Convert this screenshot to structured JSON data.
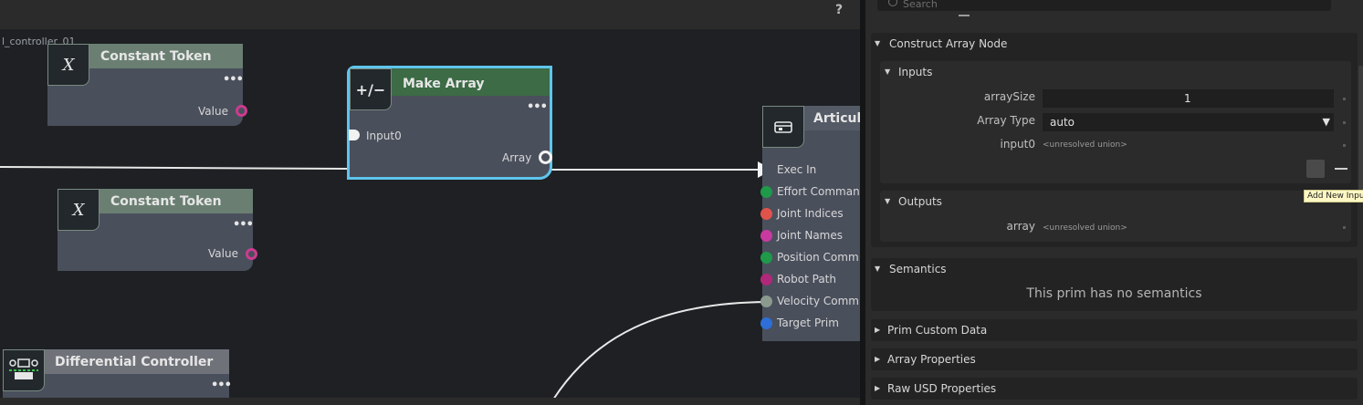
{
  "graph": {
    "help_label": "?",
    "graph_name": "l_controller_01",
    "nodes": {
      "constant1": {
        "title": "Constant Token",
        "icon": "X",
        "dots": "•••",
        "port": "Value"
      },
      "constant2": {
        "title": "Constant Token",
        "icon": "X",
        "dots": "•••",
        "port": "Value"
      },
      "make_array": {
        "title": "Make Array",
        "icon": "+/−",
        "dots": "•••",
        "input": "Input0",
        "output": "Array"
      },
      "articulation": {
        "title": "Articula",
        "ports": [
          "Exec In",
          "Effort Comman",
          "Joint Indices",
          "Joint Names",
          "Position Comm",
          "Robot Path",
          "Velocity Comm",
          "Target Prim"
        ],
        "port_colors": [
          "#e8e8e8",
          "#1e9a4a",
          "#e0524c",
          "#c93aa0",
          "#1e9a4a",
          "#b0287a",
          "#8a9a8e",
          "#2d6fd6"
        ]
      },
      "differential": {
        "title": "Differential Controller",
        "dots": "•••"
      }
    }
  },
  "panel": {
    "search_placeholder": "Search",
    "construct_section": "Construct Array Node",
    "inputs_section": "Inputs",
    "array_size_label": "arraySize",
    "array_size_value": "1",
    "array_type_label": "Array Type",
    "array_type_value": "auto",
    "input0_label": "input0",
    "input0_value": "<unresolved union>",
    "add_input_tooltip": "Add New Inpu",
    "outputs_section": "Outputs",
    "array_label": "array",
    "array_value": "<unresolved union>",
    "semantics_section": "Semantics",
    "semantics_message": "This prim has no semantics",
    "prim_custom_data": "Prim Custom Data",
    "array_properties": "Array Properties",
    "raw_usd_properties": "Raw USD Properties"
  }
}
